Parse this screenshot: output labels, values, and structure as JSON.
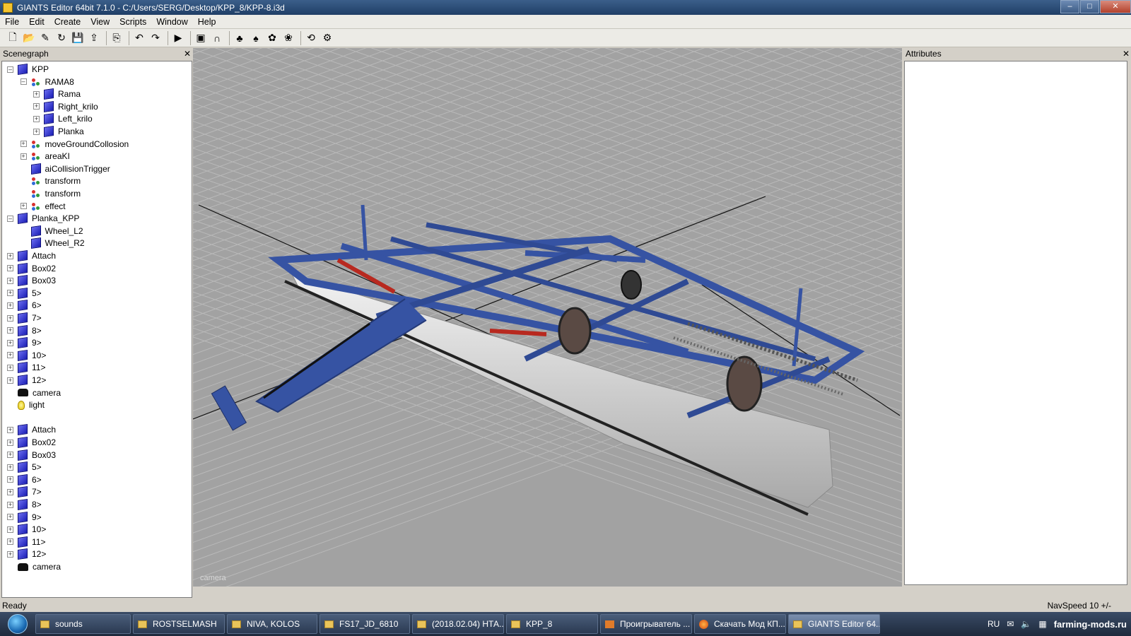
{
  "window": {
    "title": "GIANTS Editor 64bit 7.1.0 - C:/Users/SERG/Desktop/KPP_8/KPP-8.i3d"
  },
  "menu": [
    "File",
    "Edit",
    "Create",
    "View",
    "Scripts",
    "Window",
    "Help"
  ],
  "toolbar": [
    {
      "name": "new-file-icon",
      "glyph": "🗋"
    },
    {
      "name": "open-icon",
      "glyph": "📂"
    },
    {
      "name": "edit-icon",
      "glyph": "✎"
    },
    {
      "name": "reload-icon",
      "glyph": "↻"
    },
    {
      "name": "save-icon",
      "glyph": "💾"
    },
    {
      "name": "export-icon",
      "glyph": "⇪"
    },
    {
      "sep": true
    },
    {
      "name": "import-icon",
      "glyph": "⎘"
    },
    {
      "sep": true
    },
    {
      "name": "undo-icon",
      "glyph": "↶"
    },
    {
      "name": "redo-icon",
      "glyph": "↷"
    },
    {
      "sep": true
    },
    {
      "name": "play-icon",
      "glyph": "▶"
    },
    {
      "sep": true
    },
    {
      "name": "select-tool-icon",
      "glyph": "▣"
    },
    {
      "name": "magnet-icon",
      "glyph": "∩"
    },
    {
      "sep": true
    },
    {
      "name": "terrain-paint-icon",
      "glyph": "♣"
    },
    {
      "name": "terrain-sculpt-icon",
      "glyph": "♠"
    },
    {
      "name": "foliage-icon",
      "glyph": "✿"
    },
    {
      "name": "plant-icon",
      "glyph": "❀"
    },
    {
      "sep": true
    },
    {
      "name": "sync-icon",
      "glyph": "⟲"
    },
    {
      "name": "settings-icon",
      "glyph": "⚙"
    }
  ],
  "scenegraph": {
    "title": "Scenegraph",
    "nodes": [
      {
        "label": "KPP",
        "depth": 0,
        "icon": "shape",
        "expander": "minus"
      },
      {
        "label": "RAMA8",
        "depth": 1,
        "icon": "transform",
        "expander": "minus"
      },
      {
        "label": "Rama",
        "depth": 2,
        "icon": "shape",
        "expander": "plus"
      },
      {
        "label": "Right_krilo",
        "depth": 2,
        "icon": "shape",
        "expander": "plus"
      },
      {
        "label": "Left_krilo",
        "depth": 2,
        "icon": "shape",
        "expander": "plus"
      },
      {
        "label": "Planka",
        "depth": 2,
        "icon": "shape",
        "expander": "plus"
      },
      {
        "label": "moveGroundCollosion",
        "depth": 1,
        "icon": "transform",
        "expander": "plus"
      },
      {
        "label": "areaKI",
        "depth": 1,
        "icon": "transform",
        "expander": "plus"
      },
      {
        "label": "aiCollisionTrigger",
        "depth": 1,
        "icon": "shape",
        "expander": "none"
      },
      {
        "label": "transform",
        "depth": 1,
        "icon": "transform",
        "expander": "none"
      },
      {
        "label": "transform",
        "depth": 1,
        "icon": "transform",
        "expander": "none"
      },
      {
        "label": "effect",
        "depth": 1,
        "icon": "transform",
        "expander": "plus"
      },
      {
        "label": "Planka_KPP",
        "depth": 0,
        "icon": "shape",
        "expander": "minus"
      },
      {
        "label": "Wheel_L2",
        "depth": 1,
        "icon": "shape",
        "expander": "none"
      },
      {
        "label": "Wheel_R2",
        "depth": 1,
        "icon": "shape",
        "expander": "none"
      },
      {
        "label": "Attach",
        "depth": 0,
        "icon": "shape",
        "expander": "plus"
      },
      {
        "label": "Box02",
        "depth": 0,
        "icon": "shape",
        "expander": "plus"
      },
      {
        "label": "Box03",
        "depth": 0,
        "icon": "shape",
        "expander": "plus"
      },
      {
        "label": "5>",
        "depth": 0,
        "icon": "shape",
        "expander": "plus"
      },
      {
        "label": "6>",
        "depth": 0,
        "icon": "shape",
        "expander": "plus"
      },
      {
        "label": "7>",
        "depth": 0,
        "icon": "shape",
        "expander": "plus"
      },
      {
        "label": "8>",
        "depth": 0,
        "icon": "shape",
        "expander": "plus"
      },
      {
        "label": "9>",
        "depth": 0,
        "icon": "shape",
        "expander": "plus"
      },
      {
        "label": "10>",
        "depth": 0,
        "icon": "shape",
        "expander": "plus"
      },
      {
        "label": "11>",
        "depth": 0,
        "icon": "shape",
        "expander": "plus"
      },
      {
        "label": "12>",
        "depth": 0,
        "icon": "shape",
        "expander": "plus"
      },
      {
        "label": "camera",
        "depth": 0,
        "icon": "camera",
        "expander": "none"
      },
      {
        "label": "light",
        "depth": 0,
        "icon": "light",
        "expander": "none"
      },
      {
        "label": "",
        "depth": 0,
        "icon": "none",
        "expander": "none"
      },
      {
        "label": "Attach",
        "depth": 0,
        "icon": "shape",
        "expander": "plus"
      },
      {
        "label": "Box02",
        "depth": 0,
        "icon": "shape",
        "expander": "plus"
      },
      {
        "label": "Box03",
        "depth": 0,
        "icon": "shape",
        "expander": "plus"
      },
      {
        "label": "5>",
        "depth": 0,
        "icon": "shape",
        "expander": "plus"
      },
      {
        "label": "6>",
        "depth": 0,
        "icon": "shape",
        "expander": "plus"
      },
      {
        "label": "7>",
        "depth": 0,
        "icon": "shape",
        "expander": "plus"
      },
      {
        "label": "8>",
        "depth": 0,
        "icon": "shape",
        "expander": "plus"
      },
      {
        "label": "9>",
        "depth": 0,
        "icon": "shape",
        "expander": "plus"
      },
      {
        "label": "10>",
        "depth": 0,
        "icon": "shape",
        "expander": "plus"
      },
      {
        "label": "11>",
        "depth": 0,
        "icon": "shape",
        "expander": "plus"
      },
      {
        "label": "12>",
        "depth": 0,
        "icon": "shape",
        "expander": "plus"
      },
      {
        "label": "camera",
        "depth": 0,
        "icon": "camera",
        "expander": "none"
      }
    ]
  },
  "viewport": {
    "camera_label": "camera"
  },
  "attributes": {
    "title": "Attributes"
  },
  "status": {
    "left": "Ready",
    "right": "NavSpeed 10 +/-"
  },
  "taskbar": {
    "items": [
      {
        "label": "sounds",
        "icon": "folder",
        "active": false
      },
      {
        "label": "ROSTSELMASH",
        "icon": "folder",
        "active": false
      },
      {
        "label": "NIVA, KOLOS",
        "icon": "folder",
        "active": false
      },
      {
        "label": "FS17_JD_6810",
        "icon": "folder",
        "active": false
      },
      {
        "label": "(2018.02.04) НТА...",
        "icon": "folder",
        "active": false
      },
      {
        "label": "KPP_8",
        "icon": "folder",
        "active": false
      },
      {
        "label": "Проигрыватель ...",
        "icon": "media",
        "active": false
      },
      {
        "label": "Скачать Мод КП...",
        "icon": "firefox",
        "active": false
      },
      {
        "label": "GIANTS Editor 64...",
        "icon": "folder",
        "active": true
      }
    ],
    "tray_lang": "RU",
    "watermark": "farming-mods.ru"
  },
  "colors": {
    "viewport_bg": "#a2a2a2",
    "machine_blue": "#3653a3"
  }
}
